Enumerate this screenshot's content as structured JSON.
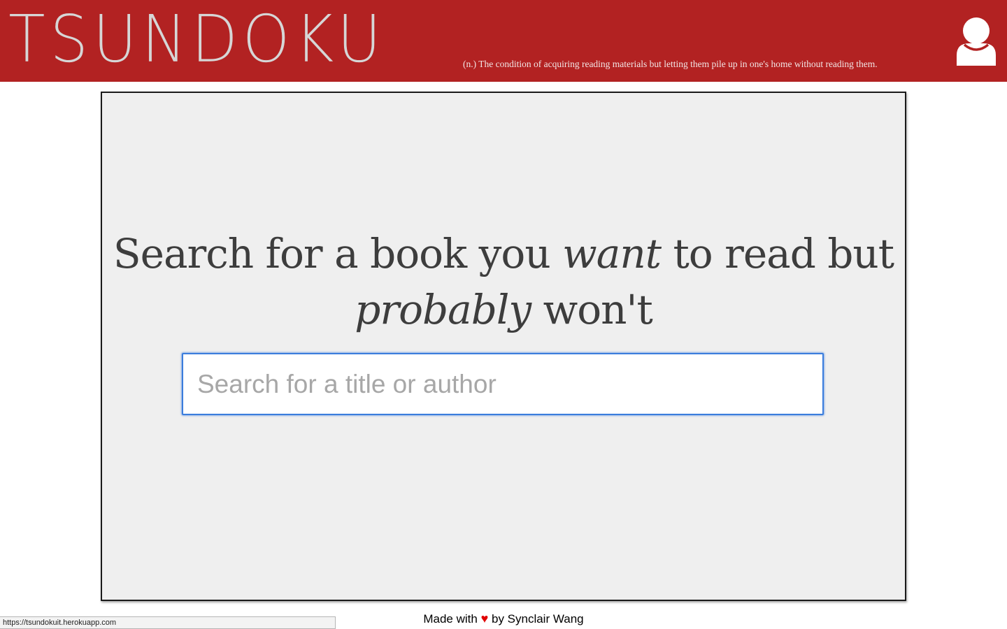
{
  "header": {
    "brand": "TSUNDOKU",
    "definition": "(n.) The condition of acquiring reading materials but letting them pile up in one's home without reading them.",
    "user_icon": "user-icon",
    "bg_color": "#b22222"
  },
  "main": {
    "headline": {
      "part1": "Search for a book you ",
      "italic1": "want",
      "part2": " to read but ",
      "italic2": "probably",
      "part3": " won't"
    },
    "search": {
      "placeholder": "Search for a title or author",
      "value": ""
    }
  },
  "footer": {
    "prefix": "Made with",
    "heart": "♥",
    "suffix": "by Synclair Wang"
  },
  "status_bar": {
    "url": "https://tsundokuit.herokuapp.com"
  }
}
